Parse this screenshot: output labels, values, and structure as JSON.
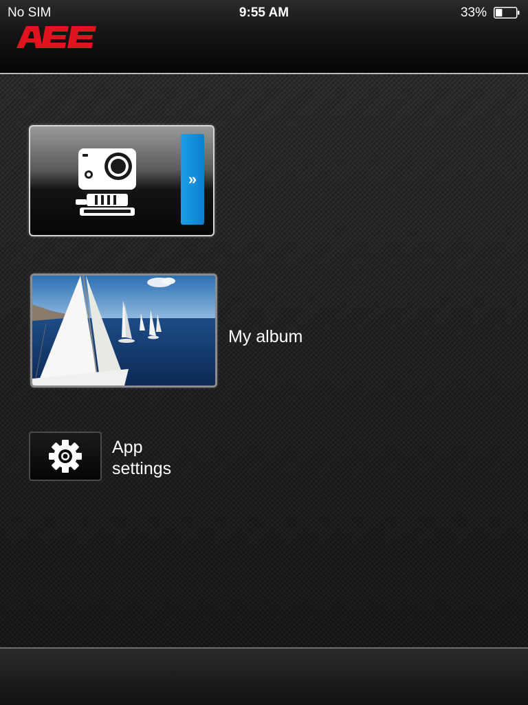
{
  "status_bar": {
    "carrier": "No SIM",
    "time": "9:55 AM",
    "battery_percent": "33%",
    "battery_level": 0.33
  },
  "brand": {
    "logo_text": "AEE",
    "logo_color": "#e0141e"
  },
  "menu": {
    "camera": {
      "icon": "action-camera-icon",
      "arrow_glyph": "»",
      "accent_color": "#1b9fe6"
    },
    "album": {
      "label": "My album",
      "thumbnail": "sailboats-photo"
    },
    "settings": {
      "label_line1": "App",
      "label_line2": "settings",
      "icon": "gear-icon"
    }
  }
}
